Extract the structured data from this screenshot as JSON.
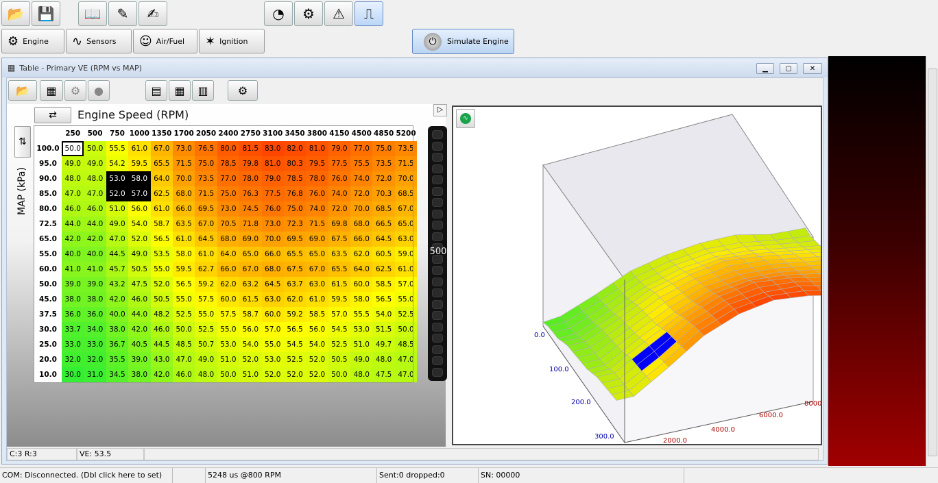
{
  "colors": {
    "table_low": "#33ee33",
    "table_mid": "#ffff00",
    "table_high": "#ff5500",
    "selected_cell": "#0000ff"
  },
  "toolbar": {
    "buttons": [
      {
        "icon": "open-folder-icon"
      },
      {
        "icon": "save-icon"
      },
      {
        "icon": "book-icon"
      },
      {
        "icon": "edit-icon"
      },
      {
        "icon": "edit-color-icon"
      },
      {
        "icon": "gauge-icon"
      },
      {
        "icon": "config-icon"
      },
      {
        "icon": "warning-icon"
      },
      {
        "icon": "signal-icon"
      }
    ]
  },
  "tabs": [
    {
      "label": "Engine",
      "icon": "engine-icon"
    },
    {
      "label": "Sensors",
      "icon": "sensor-wave-icon"
    },
    {
      "label": "Air/Fuel",
      "icon": "person-icon"
    },
    {
      "label": "Ignition",
      "icon": "spark-plug-icon"
    }
  ],
  "simulate": {
    "label": "Simulate Engine"
  },
  "window": {
    "title": "Table - Primary VE (RPM vs MAP)"
  },
  "table": {
    "x_axis_label": "Engine Speed (RPM)",
    "y_axis_label": "MAP (kPa)",
    "rpm": [
      "250",
      "500",
      "750",
      "1000",
      "1350",
      "1700",
      "2050",
      "2400",
      "2750",
      "3100",
      "3450",
      "3800",
      "4150",
      "4500",
      "4850",
      "5200"
    ],
    "rows": [
      {
        "map": "100.0",
        "vals": [
          "50.0",
          "50.0",
          "55.5",
          "61.0",
          "67.0",
          "73.0",
          "76.5",
          "80.0",
          "81.5",
          "83.0",
          "82.0",
          "81.0",
          "79.0",
          "77.0",
          "75.0",
          "73.5"
        ]
      },
      {
        "map": "95.0",
        "vals": [
          "49.0",
          "49.0",
          "54.2",
          "59.5",
          "65.5",
          "71.5",
          "75.0",
          "78.5",
          "79.8",
          "81.0",
          "80.3",
          "79.5",
          "77.5",
          "75.5",
          "73.5",
          "71.5"
        ]
      },
      {
        "map": "90.0",
        "vals": [
          "48.0",
          "48.0",
          "53.0",
          "58.0",
          "64.0",
          "70.0",
          "73.5",
          "77.0",
          "78.0",
          "79.0",
          "78.5",
          "78.0",
          "76.0",
          "74.0",
          "72.0",
          "70.0"
        ]
      },
      {
        "map": "85.0",
        "vals": [
          "47.0",
          "47.0",
          "52.0",
          "57.0",
          "62.5",
          "68.0",
          "71.5",
          "75.0",
          "76.3",
          "77.5",
          "76.8",
          "76.0",
          "74.0",
          "72.0",
          "70.3",
          "68.5"
        ]
      },
      {
        "map": "80.0",
        "vals": [
          "46.0",
          "46.0",
          "51.0",
          "56.0",
          "61.0",
          "66.0",
          "69.5",
          "73.0",
          "74.5",
          "76.0",
          "75.0",
          "74.0",
          "72.0",
          "70.0",
          "68.5",
          "67.0"
        ]
      },
      {
        "map": "72.5",
        "vals": [
          "44.0",
          "44.0",
          "49.0",
          "54.0",
          "58.7",
          "63.5",
          "67.0",
          "70.5",
          "71.8",
          "73.0",
          "72.3",
          "71.5",
          "69.8",
          "68.0",
          "66.5",
          "65.0"
        ]
      },
      {
        "map": "65.0",
        "vals": [
          "42.0",
          "42.0",
          "47.0",
          "52.0",
          "56.5",
          "61.0",
          "64.5",
          "68.0",
          "69.0",
          "70.0",
          "69.5",
          "69.0",
          "67.5",
          "66.0",
          "64.5",
          "63.0"
        ]
      },
      {
        "map": "55.0",
        "vals": [
          "40.0",
          "40.0",
          "44.5",
          "49.0",
          "53.5",
          "58.0",
          "61.0",
          "64.0",
          "65.0",
          "66.0",
          "65.5",
          "65.0",
          "63.5",
          "62.0",
          "60.5",
          "59.0"
        ]
      },
      {
        "map": "60.0",
        "vals": [
          "41.0",
          "41.0",
          "45.7",
          "50.5",
          "55.0",
          "59.5",
          "62.7",
          "66.0",
          "67.0",
          "68.0",
          "67.5",
          "67.0",
          "65.5",
          "64.0",
          "62.5",
          "61.0"
        ]
      },
      {
        "map": "50.0",
        "vals": [
          "39.0",
          "39.0",
          "43.2",
          "47.5",
          "52.0",
          "56.5",
          "59.2",
          "62.0",
          "63.2",
          "64.5",
          "63.7",
          "63.0",
          "61.5",
          "60.0",
          "58.5",
          "57.0"
        ]
      },
      {
        "map": "45.0",
        "vals": [
          "38.0",
          "38.0",
          "42.0",
          "46.0",
          "50.5",
          "55.0",
          "57.5",
          "60.0",
          "61.5",
          "63.0",
          "62.0",
          "61.0",
          "59.5",
          "58.0",
          "56.5",
          "55.0"
        ]
      },
      {
        "map": "37.5",
        "vals": [
          "36.0",
          "36.0",
          "40.0",
          "44.0",
          "48.2",
          "52.5",
          "55.0",
          "57.5",
          "58.7",
          "60.0",
          "59.2",
          "58.5",
          "57.0",
          "55.5",
          "54.0",
          "52.5"
        ]
      },
      {
        "map": "30.0",
        "vals": [
          "33.7",
          "34.0",
          "38.0",
          "42.0",
          "46.0",
          "50.0",
          "52.5",
          "55.0",
          "56.0",
          "57.0",
          "56.5",
          "56.0",
          "54.5",
          "53.0",
          "51.5",
          "50.0"
        ]
      },
      {
        "map": "25.0",
        "vals": [
          "33.0",
          "33.0",
          "36.7",
          "40.5",
          "44.5",
          "48.5",
          "50.7",
          "53.0",
          "54.0",
          "55.0",
          "54.5",
          "54.0",
          "52.5",
          "51.0",
          "49.7",
          "48.5"
        ]
      },
      {
        "map": "20.0",
        "vals": [
          "32.0",
          "32.0",
          "35.5",
          "39.0",
          "43.0",
          "47.0",
          "49.0",
          "51.0",
          "52.0",
          "53.0",
          "52.5",
          "52.0",
          "50.5",
          "49.0",
          "48.0",
          "47.0"
        ]
      },
      {
        "map": "10.0",
        "vals": [
          "30.0",
          "31.0",
          "34.5",
          "38.0",
          "42.0",
          "46.0",
          "48.0",
          "50.0",
          "51.0",
          "52.0",
          "52.0",
          "52.0",
          "50.0",
          "48.0",
          "47.5",
          "47.0"
        ]
      }
    ],
    "current_cell": {
      "row": 0,
      "col": 0
    },
    "highlighted_cells": [
      [
        2,
        2
      ],
      [
        2,
        3
      ],
      [
        3,
        2
      ],
      [
        3,
        3
      ]
    ]
  },
  "slider": {
    "value": "500"
  },
  "chart3d": {
    "axis_labels": [
      "0.0",
      "100.0",
      "200.0",
      "300.0",
      "2000.0",
      "4000.0",
      "6000.0",
      "8000"
    ]
  },
  "window_status": {
    "cell": "C:3 R:3",
    "value": "VE: 53.5"
  },
  "status": {
    "com": "COM: Disconnected. (Dbl click here to set)",
    "blank": "",
    "timing": "5248 us @800  RPM",
    "sent": "Sent:0 dropped:0",
    "sn": "SN: 00000"
  }
}
